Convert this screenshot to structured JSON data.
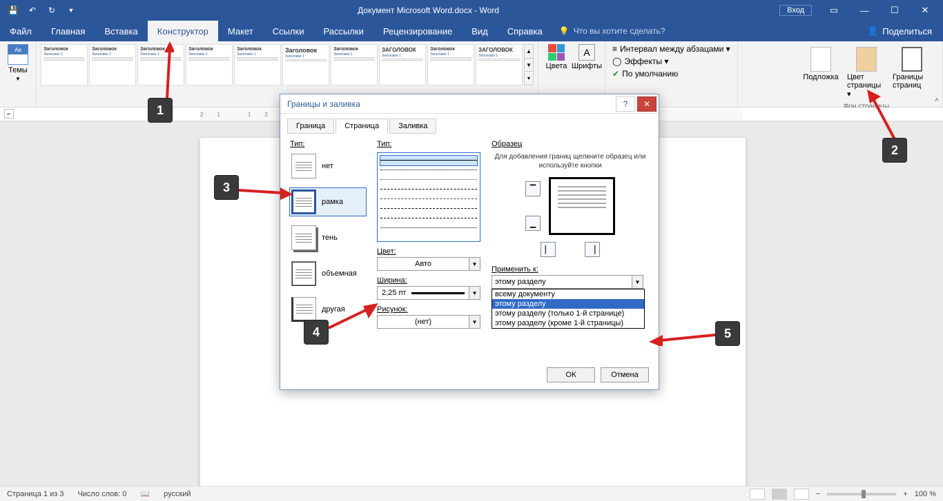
{
  "titlebar": {
    "doc_title": "Документ Microsoft Word.docx  -  Word",
    "login": "Вход"
  },
  "tabs": {
    "file": "Файл",
    "home": "Главная",
    "insert": "Вставка",
    "design": "Конструктор",
    "layout": "Макет",
    "references": "Ссылки",
    "mailings": "Рассылки",
    "review": "Рецензирование",
    "view": "Вид",
    "help": "Справка",
    "tell_me": "Что вы хотите сделать?",
    "share": "Поделиться"
  },
  "ribbon": {
    "themes": "Темы",
    "gallery_heading": "Заголовок",
    "gallery_heading_caps": "ЗАГОЛОВОК",
    "gallery_sub": "Заголовок 1",
    "colors": "Цвета",
    "fonts": "Шрифты",
    "spacing": "Интервал между абзацами ▾",
    "effects": "Эффекты ▾",
    "default": "По умолчанию",
    "watermark": "Подложка",
    "page_color": "Цвет страницы ▾",
    "page_borders": "Границы страниц",
    "bg_group": "Фон страницы"
  },
  "dialog": {
    "title": "Границы и заливка",
    "tab_border": "Граница",
    "tab_page": "Страница",
    "tab_shading": "Заливка",
    "type_label": "Тип:",
    "type_none": "нет",
    "type_box": "рамка",
    "type_shadow": "тень",
    "type_3d": "объемная",
    "type_custom": "другая",
    "style_label": "Тип:",
    "color_label": "Цвет:",
    "color_auto": "Авто",
    "width_label": "Ширина:",
    "width_val": "2,25 пт",
    "art_label": "Рисунок:",
    "art_none": "(нет)",
    "preview_label": "Образец",
    "preview_hint": "Для добавления границ щелкните образец или используйте кнопки",
    "apply_label": "Применить к:",
    "apply_current": "этому разделу",
    "apply_opts": [
      "всему документу",
      "этому разделу",
      "этому разделу (только 1-й странице)",
      "этому разделу (кроме 1-й страницы)"
    ],
    "ok": "ОК",
    "cancel": "Отмена"
  },
  "callouts": {
    "1": "1",
    "2": "2",
    "3": "3",
    "4": "4",
    "5": "5"
  },
  "status": {
    "page": "Страница 1 из 3",
    "words": "Число слов: 0",
    "lang": "русский",
    "zoom": "100 %"
  }
}
